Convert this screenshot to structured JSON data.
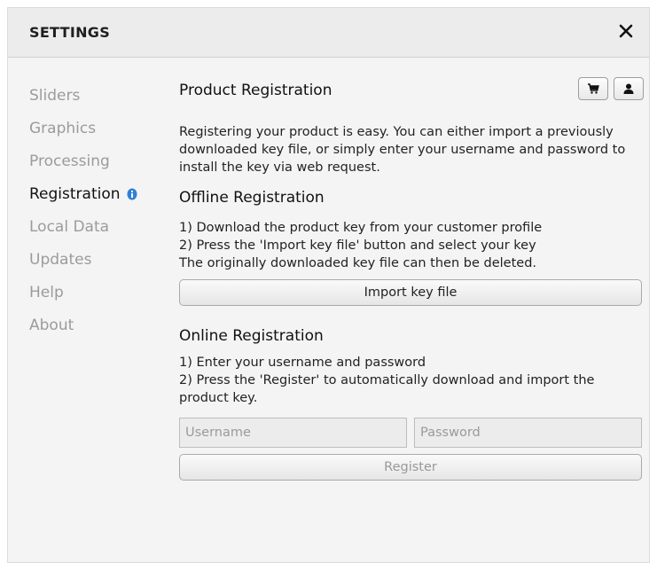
{
  "header": {
    "title": "SETTINGS",
    "close_icon": "close-icon"
  },
  "sidebar": {
    "items": [
      {
        "label": "Sliders"
      },
      {
        "label": "Graphics"
      },
      {
        "label": "Processing"
      },
      {
        "label": "Registration",
        "active": true,
        "icon": "info-icon"
      },
      {
        "label": "Local Data"
      },
      {
        "label": "Updates"
      },
      {
        "label": "Help"
      },
      {
        "label": "About"
      }
    ]
  },
  "content": {
    "title": "Product Registration",
    "corner_icons": [
      "cart-icon",
      "user-icon"
    ],
    "intro": "Registering your product is easy. You can either import a previously downloaded key file, or simply enter your username and password to install the key via web request.",
    "offline": {
      "title": "Offline Registration",
      "lines": [
        "1) Download the product key from your customer profile",
        "2) Press the 'Import key file' button and select your key",
        "The originally downloaded key file can then be deleted."
      ],
      "button_label": "Import key file"
    },
    "online": {
      "title": "Online Registration",
      "lines": [
        "1) Enter your username and password",
        "2) Press the 'Register' to automatically download and import the product key."
      ],
      "username_placeholder": "Username",
      "password_placeholder": "Password",
      "button_label": "Register"
    }
  },
  "colors": {
    "active_text": "#111111",
    "inactive_text": "#9b9b9b",
    "info_icon": "#2f7fd8"
  }
}
